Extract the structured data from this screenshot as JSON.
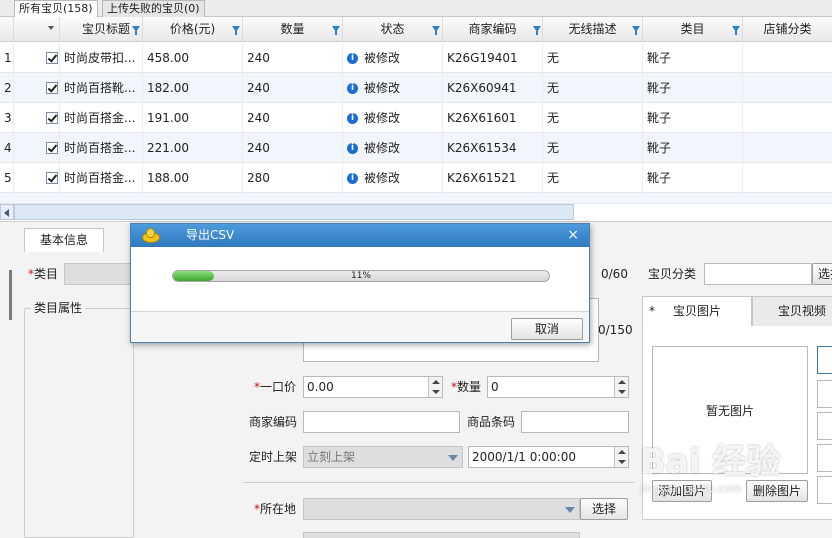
{
  "top_tabs": [
    {
      "label": "所有宝贝(158)",
      "active": true
    },
    {
      "label": "上传失败的宝贝(0)",
      "active": false
    }
  ],
  "grid": {
    "columns": [
      "宝贝标题",
      "价格(元)",
      "数量",
      "状态",
      "商家编码",
      "无线描述",
      "类目",
      "店铺分类"
    ],
    "rows": [
      {
        "num": "1",
        "title": "时尚皮带扣...",
        "price": "458.00",
        "qty": "240",
        "status": "被修改",
        "code": "K26G19401",
        "wireless": "无",
        "category": "靴子"
      },
      {
        "num": "2",
        "title": "时尚百搭靴...",
        "price": "182.00",
        "qty": "240",
        "status": "被修改",
        "code": "K26X60941",
        "wireless": "无",
        "category": "靴子"
      },
      {
        "num": "3",
        "title": "时尚百搭金...",
        "price": "191.00",
        "qty": "240",
        "status": "被修改",
        "code": "K26X61601",
        "wireless": "无",
        "category": "靴子"
      },
      {
        "num": "4",
        "title": "时尚百搭金...",
        "price": "221.00",
        "qty": "240",
        "status": "被修改",
        "code": "K26X61534",
        "wireless": "无",
        "category": "靴子"
      },
      {
        "num": "5",
        "title": "时尚百搭金...",
        "price": "188.00",
        "qty": "280",
        "status": "被修改",
        "code": "K26X61521",
        "wireless": "无",
        "category": "靴子"
      }
    ]
  },
  "form": {
    "tab_basic": "基本信息",
    "category_label": "类目",
    "category_props_label": "类目属性",
    "title_counter": "0/60",
    "desc_counter": "0/150",
    "shop_category_label": "宝贝分类",
    "shop_category_button": "选择",
    "price_label": "一口价",
    "price_value": "0.00",
    "qty_label": "数量",
    "qty_value": "0",
    "merchant_code_label": "商家编码",
    "barcode_label": "商品条码",
    "schedule_label": "定时上架",
    "schedule_value": "立刻上架",
    "schedule_time": "2000/1/1 0:00:00",
    "location_label": "所在地",
    "location_button": "选择"
  },
  "right_panel": {
    "tab_images": "宝贝图片",
    "tab_video": "宝贝视频",
    "no_image": "暂无图片",
    "add_image": "添加图片",
    "remove_image": "删除图片"
  },
  "dialog": {
    "title": "导出CSV",
    "close": "×",
    "progress": 11,
    "progress_text": "11%",
    "cancel": "取消"
  },
  "watermark": {
    "text": "Bai 经验",
    "url": "jingyan.baidu.com"
  },
  "colors": {
    "title_bar": "#2f78bf",
    "progress": "#3aa52a",
    "status_info": "#1a6dd0",
    "required": "#d01010"
  }
}
